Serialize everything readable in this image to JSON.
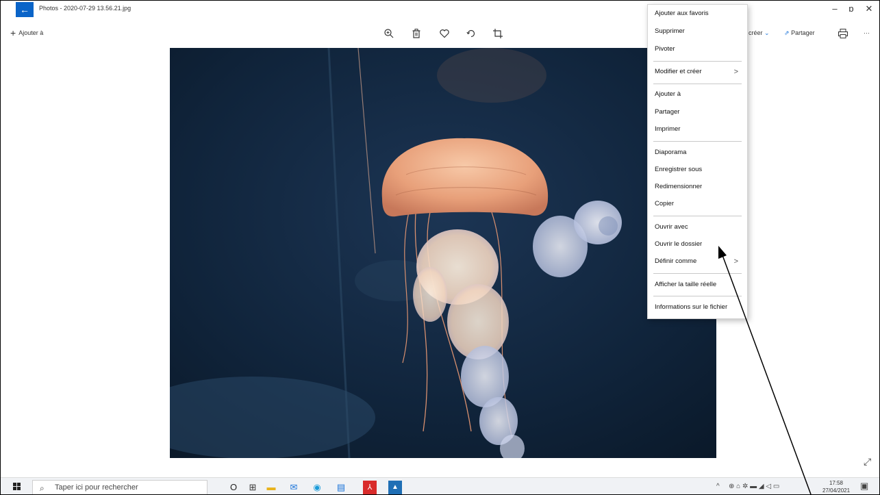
{
  "window": {
    "title": "Photos - 2020-07-29 13.56.21.jpg",
    "back_glyph": "←",
    "minimize_glyph": "–",
    "restore_glyph": "ɒ",
    "close_glyph": "✕"
  },
  "toolbar": {
    "add_label": "Ajouter à",
    "add_glyph": "+",
    "create_label": "créer",
    "share_label": "Partager",
    "more_glyph": "···"
  },
  "context_menu": {
    "items": [
      {
        "label": "Ajouter aux favoris"
      },
      {
        "label": "Supprimer"
      },
      {
        "label": "Pivoter"
      },
      {
        "label": "Modifier et créer",
        "submenu": true
      },
      {
        "label": "Ajouter à"
      },
      {
        "label": "Partager"
      },
      {
        "label": "Imprimer"
      },
      {
        "label": "Diaporama"
      },
      {
        "label": "Enregistrer sous"
      },
      {
        "label": "Redimensionner"
      },
      {
        "label": "Copier"
      },
      {
        "label": "Ouvrir avec"
      },
      {
        "label": "Ouvrir le dossier"
      },
      {
        "label": "Définir comme",
        "submenu": true
      },
      {
        "label": "Afficher la taille réelle"
      },
      {
        "label": "Informations sur le fichier"
      }
    ],
    "chevron": ">"
  },
  "taskbar": {
    "search_placeholder": "Taper ici pour rechercher",
    "cortana_glyph": "O",
    "taskview_glyph": "⊞",
    "clock_time": "17:58",
    "clock_date": "27/04/2021",
    "tray_chevron": "^"
  },
  "colors": {
    "accent": "#1a73d9",
    "back_button": "#0a64c8",
    "photo_background": "#0d1f33"
  }
}
